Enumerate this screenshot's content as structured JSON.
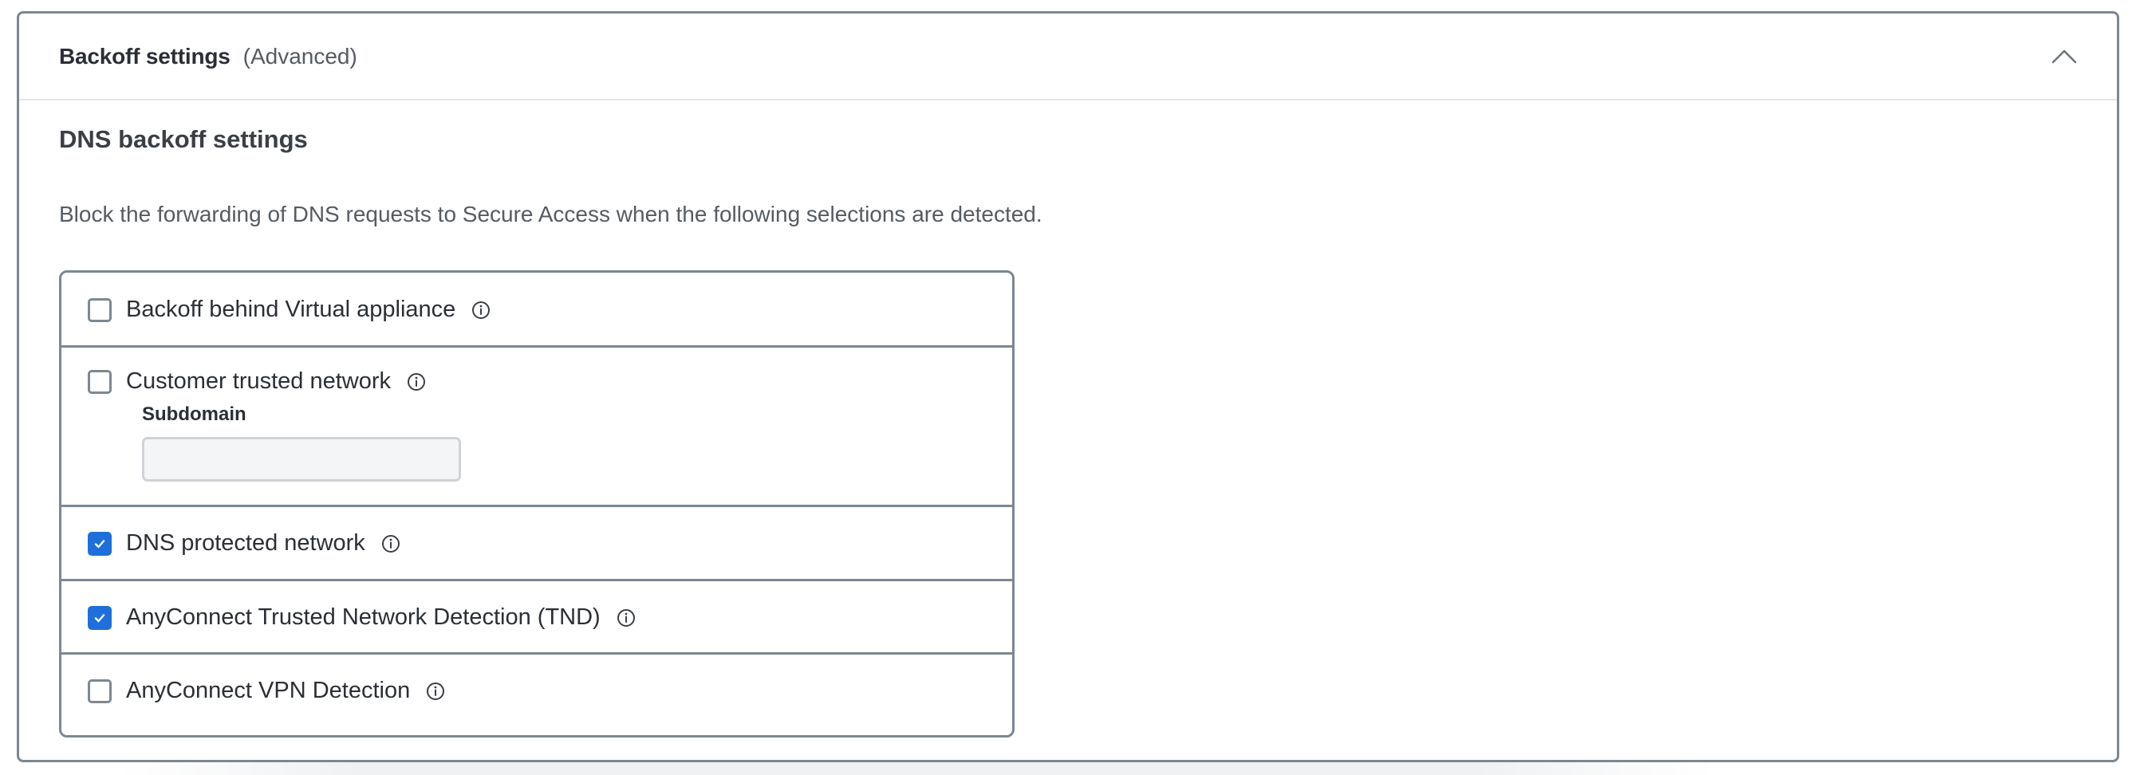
{
  "panel": {
    "title": "Backoff settings",
    "subtitle": "(Advanced)",
    "collapse_icon": "chevron-up-icon"
  },
  "section": {
    "title": "DNS backoff settings",
    "description": "Block the forwarding of DNS requests to Secure Access when the following selections are detected."
  },
  "options": [
    {
      "label": "Backoff behind Virtual appliance",
      "checked": false,
      "icon": "info-icon"
    },
    {
      "label": "Customer trusted network",
      "checked": false,
      "icon": "info-icon"
    },
    {
      "label": "DNS protected network",
      "checked": true,
      "icon": "info-icon"
    },
    {
      "label": "AnyConnect Trusted Network Detection (TND)",
      "checked": true,
      "icon": "info-icon"
    },
    {
      "label": "AnyConnect VPN Detection",
      "checked": false,
      "icon": "info-icon"
    }
  ],
  "subdomain": {
    "label": "Subdomain",
    "value": "",
    "placeholder": ""
  },
  "colors": {
    "accent": "#1e6fd9",
    "border": "#7d8791",
    "text": "#2b2f35",
    "muted": "#555b62"
  }
}
